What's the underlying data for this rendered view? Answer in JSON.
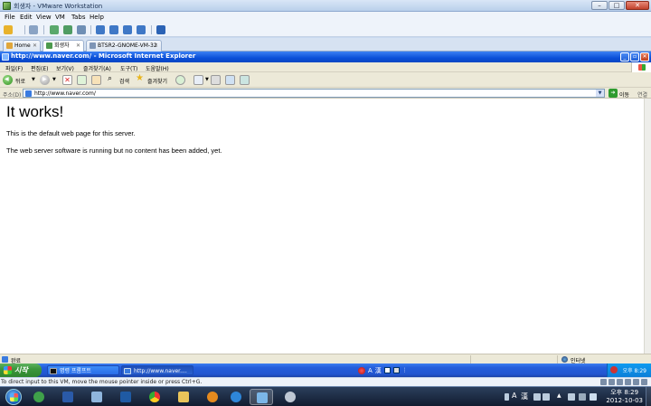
{
  "vmware": {
    "title": "회생자 - VMware Workstation",
    "menu": [
      "File",
      "Edit",
      "View",
      "VM",
      "Tabs",
      "Help"
    ],
    "tabs": [
      {
        "label": "Home",
        "active": false
      },
      {
        "label": "회생자",
        "active": true
      },
      {
        "label": "BTSR2-GNOME-VM-32",
        "active": false
      }
    ],
    "hint": "To direct input to this VM, move the mouse pointer inside or press Ctrl+G."
  },
  "ie": {
    "title": "http://www.naver.com/ - Microsoft Internet Explorer",
    "menu": [
      "파일(F)",
      "편집(E)",
      "보기(V)",
      "즐겨찾기(A)",
      "도구(T)",
      "도움말(H)"
    ],
    "toolbar": {
      "back_label": "뒤로",
      "search_label": "검색",
      "favorites_label": "즐겨찾기"
    },
    "address": {
      "label": "주소(D)",
      "url": "http://www.naver.com/",
      "go_label": "이동",
      "links_label": "연결"
    },
    "content": {
      "heading": "It works!",
      "para1": "This is the default web page for this server.",
      "para2": "The web server software is running but no content has been added, yet."
    },
    "status": {
      "text": "완료",
      "zone": "인터넷"
    }
  },
  "xp_taskbar": {
    "start_label": "시작",
    "tasks": [
      {
        "label": "명령 프롬프트",
        "active": false
      },
      {
        "label": "http://www.naver....",
        "active": true
      }
    ],
    "lang": [
      "A",
      "漢"
    ],
    "clock": "오후 8:29"
  },
  "win7_taskbar": {
    "lang": [
      "A",
      "漢"
    ],
    "time": "오후 8:29",
    "date": "2012-10-03"
  },
  "colors": {
    "xp_blue": "#245edb",
    "start_green": "#3c963c",
    "ie_title_blue": "#0a4fd8"
  }
}
